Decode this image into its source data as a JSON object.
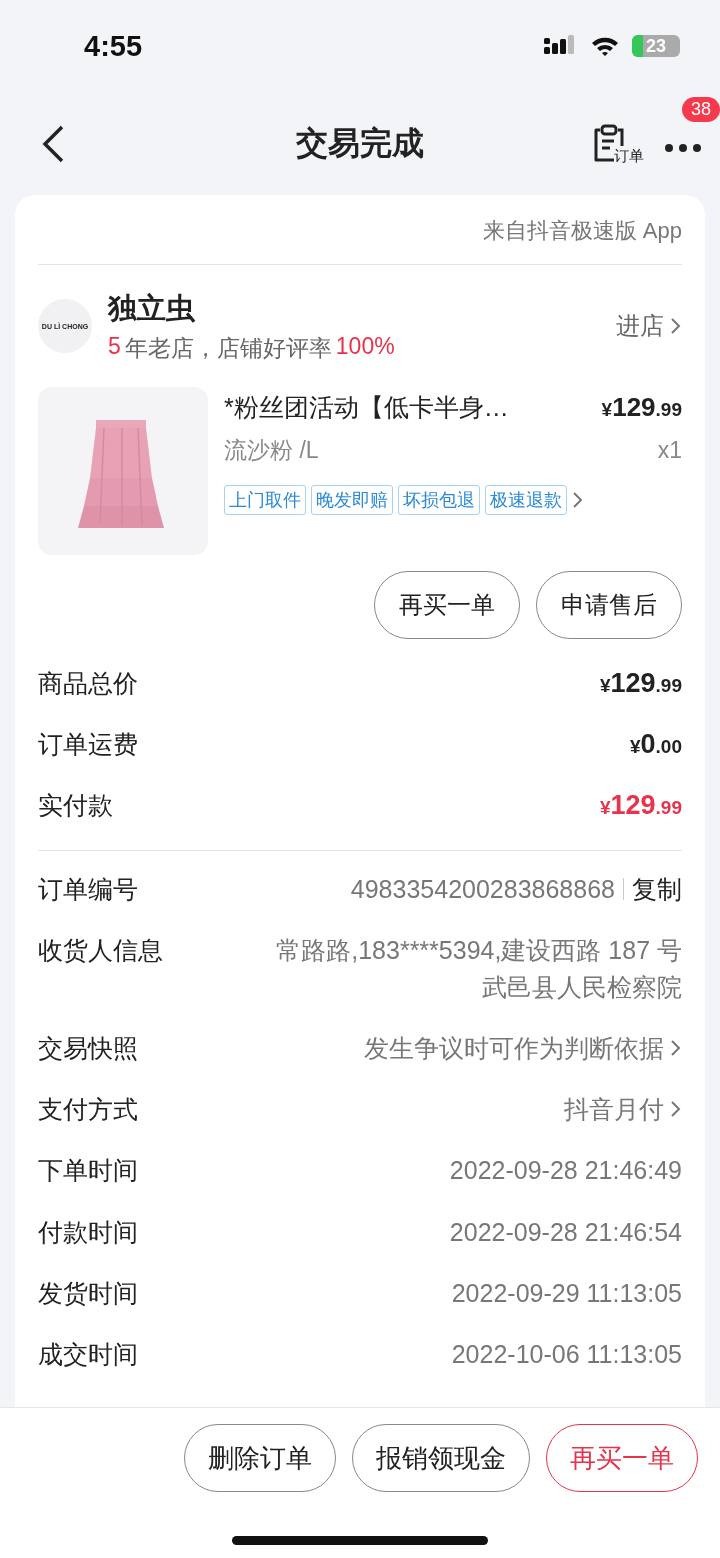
{
  "status_bar": {
    "time": "4:55",
    "battery": "23"
  },
  "nav": {
    "title": "交易完成",
    "order_label": "订单",
    "badge": "38"
  },
  "source": "来自抖音极速版 App",
  "shop": {
    "logo_text": "DU LÌ CHONG",
    "name": "独立虫",
    "years": "5",
    "years_suffix": "年老店，店铺好评率",
    "rate": "100%",
    "enter": "进店"
  },
  "product": {
    "title": "*粉丝团活动【低卡半身…",
    "price_symbol": "¥",
    "price_int": "129",
    "price_dec": ".99",
    "variant": "流沙粉 /L",
    "quantity": "x1",
    "tags": [
      "上门取件",
      "晚发即赔",
      "坏损包退",
      "极速退款"
    ]
  },
  "actions": [
    "再买一单",
    "申请售后"
  ],
  "summary": [
    {
      "label": "商品总价",
      "symbol": "¥",
      "int": "129",
      "dec": ".99",
      "highlight": false
    },
    {
      "label": "订单运费",
      "symbol": "¥",
      "int": "0",
      "dec": ".00",
      "highlight": false
    },
    {
      "label": "实付款",
      "symbol": "¥",
      "int": "129",
      "dec": ".99",
      "highlight": true
    }
  ],
  "details": [
    {
      "kind": "copy",
      "label": "订单编号",
      "value": [
        "4983354200283868868"
      ],
      "action": "复制"
    },
    {
      "kind": "text",
      "label": "收货人信息",
      "value": [
        "常路路,183****5394,建设西路 187 号",
        "武邑县人民检察院"
      ]
    },
    {
      "kind": "link",
      "label": "交易快照",
      "value": [
        "发生争议时可作为判断依据"
      ]
    },
    {
      "kind": "link",
      "label": "支付方式",
      "value": [
        "抖音月付"
      ]
    },
    {
      "kind": "text",
      "label": "下单时间",
      "value": [
        "2022-09-28 21:46:49"
      ]
    },
    {
      "kind": "text",
      "label": "付款时间",
      "value": [
        "2022-09-28 21:46:54"
      ]
    },
    {
      "kind": "text",
      "label": "发货时间",
      "value": [
        "2022-09-29 11:13:05"
      ]
    },
    {
      "kind": "text",
      "label": "成交时间",
      "value": [
        "2022-10-06 11:13:05"
      ]
    }
  ],
  "bottom_buttons": [
    {
      "label": "删除订单",
      "kind": "plain"
    },
    {
      "label": "报销领现金",
      "kind": "plain"
    },
    {
      "label": "再买一单",
      "kind": "primary"
    }
  ]
}
